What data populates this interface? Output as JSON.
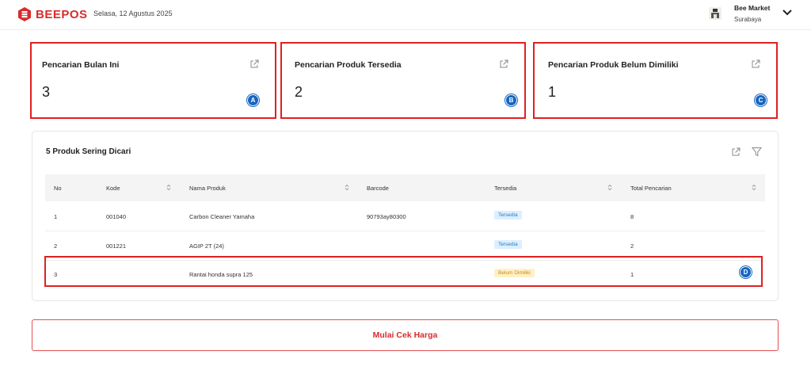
{
  "header": {
    "brand": "BEEPOS",
    "date": "Selasa, 12 Agustus 2025",
    "store_name": "Bee Market",
    "store_city": "Surabaya",
    "accent_color": "#d92b2b"
  },
  "stats": [
    {
      "title": "Pencarian Bulan Ini",
      "value": "3",
      "marker": "A"
    },
    {
      "title": "Pencarian Produk Tersedia",
      "value": "2",
      "marker": "B"
    },
    {
      "title": "Pencarian Produk Belum Dimiliki",
      "value": "1",
      "marker": "C"
    }
  ],
  "table": {
    "title": "5 Produk Sering Dicari",
    "columns": [
      "No",
      "Kode",
      "Nama Produk",
      "Barcode",
      "Tersedia",
      "Total Pencarian"
    ],
    "rows": [
      {
        "no": "1",
        "kode": "001040",
        "nama": "Carbon Cleaner Yamaha",
        "barcode": "90793ay80300",
        "tersedia": "Tersedia",
        "total": "8"
      },
      {
        "no": "2",
        "kode": "001221",
        "nama": "AGIP 2T (24)",
        "barcode": "",
        "tersedia": "Tersedia",
        "total": "2"
      },
      {
        "no": "3",
        "kode": "",
        "nama": "Rantai honda supra 125",
        "barcode": "",
        "tersedia": "Belum Dimiliki",
        "total": "1"
      }
    ],
    "row_marker": "D"
  },
  "cta": {
    "label": "Mulai Cek Harga"
  }
}
